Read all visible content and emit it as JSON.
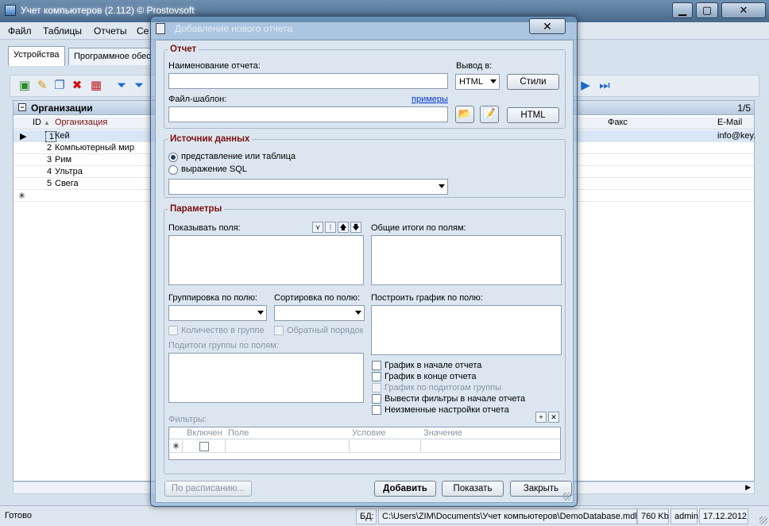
{
  "main": {
    "title": "Учет компьютеров (2.112) © Prostovsoft",
    "menu": [
      "Файл",
      "Таблицы",
      "Отчеты",
      "Се"
    ],
    "tabs": [
      "Устройства",
      "Программное обес"
    ],
    "grid": {
      "caption": "Организации",
      "count": "1/5",
      "columns": {
        "id": "ID",
        "org": "Организация",
        "fax": "Факс",
        "email": "E-Mail"
      },
      "rows": [
        {
          "id": "1",
          "org": "Кей",
          "email": "info@key."
        },
        {
          "id": "2",
          "org": "Компьютерный мир",
          "email": ""
        },
        {
          "id": "3",
          "org": "Рим",
          "email": ""
        },
        {
          "id": "4",
          "org": "Ультра",
          "email": ""
        },
        {
          "id": "5",
          "org": "Свега",
          "email": ""
        }
      ],
      "new_row_marker": "✳"
    },
    "status": {
      "ready": "Готово",
      "db_label": "БД:",
      "db_path": "C:\\Users\\ZIM\\Documents\\Учет компьютеров\\DemoDatabase.mdb",
      "size": "760 Kb",
      "user": "admin",
      "date": "17.12.2012"
    }
  },
  "dialog": {
    "title": "Добавление нового отчета",
    "report": {
      "legend": "Отчет",
      "name_label": "Наименование отчета:",
      "name_value": "",
      "output_label": "Вывод в:",
      "output_value": "HTML",
      "styles_button": "Стили",
      "template_label": "Файл-шаблон:",
      "template_value": "",
      "examples_link": "примеры",
      "html_button": "HTML"
    },
    "source": {
      "legend": "Источник данных",
      "option_view": "представление или таблица",
      "option_sql": "выражение SQL",
      "selected_value": ""
    },
    "params": {
      "legend": "Параметры",
      "show_fields_label": "Показывать поля:",
      "totals_label": "Общие итоги по полям:",
      "group_label": "Группировка по полю:",
      "sort_label": "Сортировка по полю:",
      "chart_field_label": "Построить график по полю:",
      "count_in_group": "Количество в группе",
      "reverse_order": "Обратный порядок",
      "subtotals_label": "Подитоги группы по полям:",
      "chart_at_start": "График в начале отчета",
      "chart_at_end": "График в конце отчета",
      "chart_by_subtotals": "График по подитогам группы",
      "filters_at_start": "Вывести фильтры в начале отчета",
      "fixed_settings": "Неизменные настройки отчета",
      "filters_label": "Фильтры:",
      "filter_columns": [
        "Включен",
        "Поле",
        "Условие",
        "Значение"
      ]
    },
    "buttons": {
      "schedule": "По расписанию...",
      "add": "Добавить",
      "show": "Показать",
      "close": "Закрыть"
    }
  }
}
